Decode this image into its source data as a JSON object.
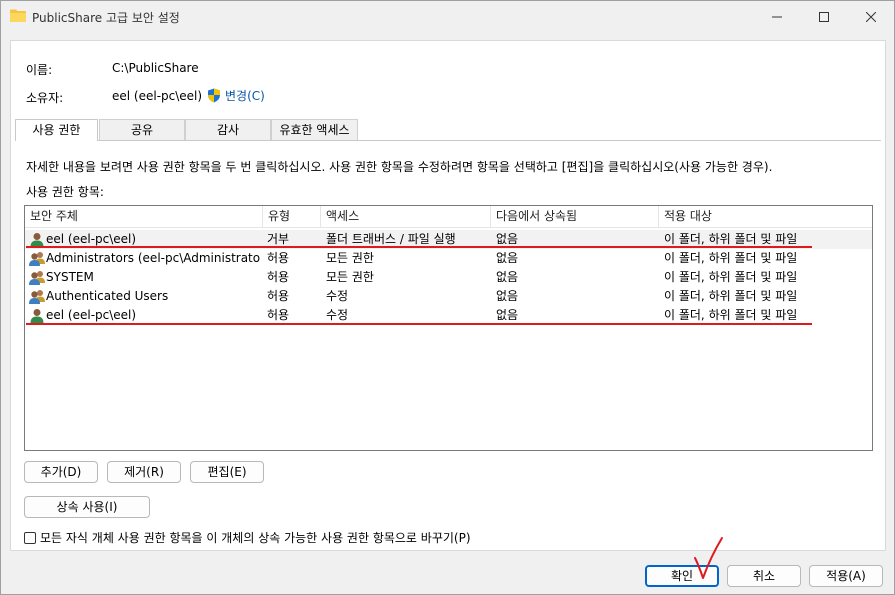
{
  "window": {
    "title": "PublicShare 고급 보안 설정"
  },
  "info": {
    "name_label": "이름:",
    "name_value": "C:\\PublicShare",
    "owner_label": "소유자:",
    "owner_value": "eel (eel-pc\\eel)",
    "change_link": "변경(C)"
  },
  "tabs": [
    {
      "label": "사용 권한",
      "active": true
    },
    {
      "label": "공유",
      "active": false
    },
    {
      "label": "감사",
      "active": false
    },
    {
      "label": "유효한 액세스",
      "active": false
    }
  ],
  "instructions": "자세한 내용을 보려면 사용 권한 항목을 두 번 클릭하십시오. 사용 권한 항목을 수정하려면 항목을 선택하고 [편집]을 클릭하십시오(사용 가능한 경우).",
  "list_label": "사용 권한 항목:",
  "columns": [
    "보안 주체",
    "유형",
    "액세스",
    "다음에서 상속됨",
    "적용 대상"
  ],
  "rows": [
    {
      "principal": "eel (eel-pc\\eel)",
      "type": "거부",
      "access": "폴더 트래버스 / 파일 실행",
      "inherited": "없음",
      "applies": "이 폴더, 하위 폴더 및 파일",
      "icon": "user-icon"
    },
    {
      "principal": "Administrators (eel-pc\\Administrators)",
      "type": "허용",
      "access": "모든 권한",
      "inherited": "없음",
      "applies": "이 폴더, 하위 폴더 및 파일",
      "icon": "group-icon"
    },
    {
      "principal": "SYSTEM",
      "type": "허용",
      "access": "모든 권한",
      "inherited": "없음",
      "applies": "이 폴더, 하위 폴더 및 파일",
      "icon": "group-icon"
    },
    {
      "principal": "Authenticated Users",
      "type": "허용",
      "access": "수정",
      "inherited": "없음",
      "applies": "이 폴더, 하위 폴더 및 파일",
      "icon": "group-icon"
    },
    {
      "principal": "eel (eel-pc\\eel)",
      "type": "허용",
      "access": "수정",
      "inherited": "없음",
      "applies": "이 폴더, 하위 폴더 및 파일",
      "icon": "user-icon"
    }
  ],
  "buttons": {
    "add": "추가(D)",
    "remove": "제거(R)",
    "edit": "편집(E)",
    "inherit": "상속 사용(I)",
    "ok": "확인",
    "cancel": "취소",
    "apply": "적용(A)"
  },
  "replace_child": "모든 자식 개체 사용 권한 항목을 이 개체의 상속 가능한 사용 권한 항목으로 바꾸기(P)",
  "colors": {
    "annotation": "#e0191f",
    "link": "#0b57a3",
    "primary_border": "#0066cc"
  }
}
